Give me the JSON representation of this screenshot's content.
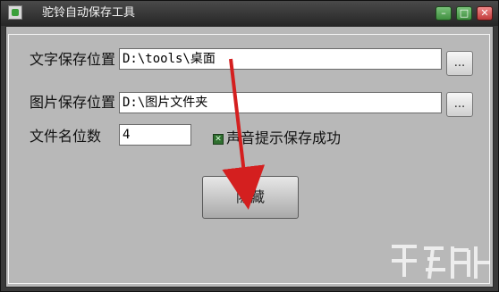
{
  "window": {
    "title": "驼铃自动保存工具",
    "controls": {
      "minimize": "–",
      "maximize": "□",
      "close": "✕"
    }
  },
  "form": {
    "text_save_location": {
      "label": "文字保存位置",
      "value": "D:\\tools\\桌面",
      "browse": "..."
    },
    "image_save_location": {
      "label": "图片保存位置",
      "value": "D:\\图片文件夹",
      "browse": "..."
    },
    "filename_digits": {
      "label": "文件名位数",
      "value": "4"
    },
    "sound_notify": {
      "label": "声音提示保存成功",
      "checked": true
    }
  },
  "actions": {
    "hide_label": "隐藏"
  },
  "icons": {
    "app": "app-icon",
    "arrow": "annotation-arrow-icon",
    "watermark": "watermark-logo-icon"
  },
  "colors": {
    "titlebar": "#2f2f2f",
    "client": "#b8b8b8",
    "arrow": "#d41f1f",
    "checkbox": "#2f6f2f"
  }
}
